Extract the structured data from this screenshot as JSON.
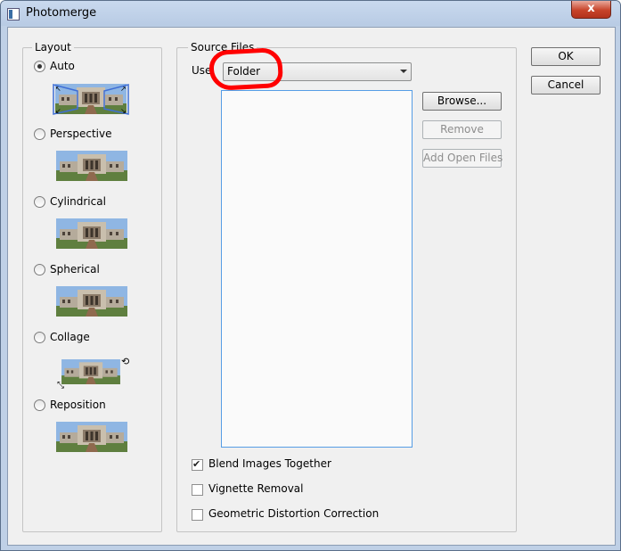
{
  "window": {
    "title": "Photomerge",
    "close_glyph": "x",
    "title_icon": "photomerge-app-icon"
  },
  "layout": {
    "legend": "Layout",
    "options": [
      {
        "label": "Auto",
        "checked": true,
        "icon": "auto-layout-thumbnail"
      },
      {
        "label": "Perspective",
        "checked": false,
        "icon": "perspective-layout-thumbnail"
      },
      {
        "label": "Cylindrical",
        "checked": false,
        "icon": "cylindrical-layout-thumbnail"
      },
      {
        "label": "Spherical",
        "checked": false,
        "icon": "spherical-layout-thumbnail"
      },
      {
        "label": "Collage",
        "checked": false,
        "icon": "collage-layout-thumbnail"
      },
      {
        "label": "Reposition",
        "checked": false,
        "icon": "reposition-layout-thumbnail"
      }
    ]
  },
  "source": {
    "legend": "Source Files",
    "use_label": "Use:",
    "use_value": "Folder",
    "files": [],
    "buttons": {
      "browse": "Browse...",
      "remove": "Remove",
      "add_open": "Add Open Files"
    },
    "checkboxes": [
      {
        "label": "Blend Images Together",
        "checked": true
      },
      {
        "label": "Vignette Removal",
        "checked": false
      },
      {
        "label": "Geometric Distortion Correction",
        "checked": false
      }
    ]
  },
  "actions": {
    "ok": "OK",
    "cancel": "Cancel"
  },
  "colors": {
    "annotation": "#ff0000",
    "title_bar": "#bfd0e6",
    "close_button": "#c7432a",
    "list_focus": "#569de5"
  }
}
